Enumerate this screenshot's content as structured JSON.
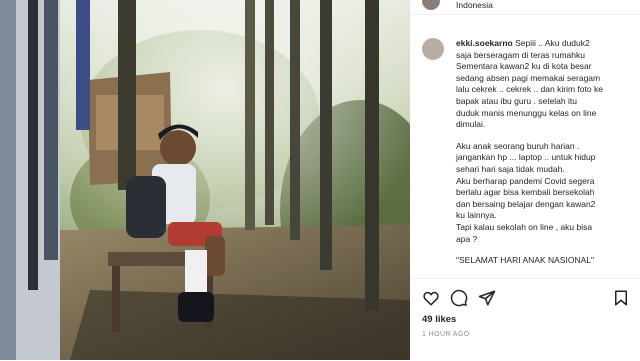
{
  "post": {
    "location": "Indonesia",
    "username": "ekki.soekarno",
    "caption_lines": [
      "Sepiii .. Aku duduk2",
      "saja berseragam di teras rumahku",
      "Sementara kawan2 ku di kota besar",
      "sedang absen pagi memakai seragam",
      "lalu cekrek .. cekrek .. dan kirim foto ke",
      "bapak atau ibu guru . setelah itu",
      "duduk manis menunggu kelas on line",
      "dimulai."
    ],
    "paragraph2": [
      "Aku anak seorang buruh harian .",
      "jangankan hp ... laptop .. untuk hidup",
      "sehari hari saja tidak mudah."
    ],
    "paragraph3": [
      "Aku berharap pandemi Covid segera",
      "berlalu agar bisa kembali bersekolah",
      "dan bersaing belajar dengan kawan2",
      "ku lainnya."
    ],
    "paragraph4": [
      "Tapi kalau sekolah on line , aku bisa",
      "apa ?"
    ],
    "paragraph5": [
      "\"SELAMAT HARI ANAK NASIONAL\""
    ],
    "likes": "49 likes",
    "time": "1 HOUR AGO"
  },
  "icons": [
    "heart-icon",
    "comment-icon",
    "share-icon",
    "bookmark-icon"
  ]
}
